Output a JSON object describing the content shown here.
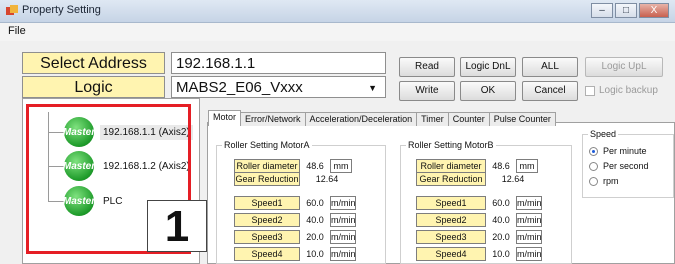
{
  "window": {
    "title": "Property Setting",
    "min_label": "–",
    "max_label": "□",
    "close_label": "X"
  },
  "menu": {
    "file_label": "File"
  },
  "address": {
    "label": "Select Address",
    "value": "192.168.1.1"
  },
  "logic": {
    "label": "Logic",
    "value": "MABS2_E06_Vxxx"
  },
  "buttons": {
    "read": "Read",
    "logic_dnl": "Logic DnL",
    "all": "ALL",
    "logic_upl": "Logic UpL",
    "write": "Write",
    "ok": "OK",
    "cancel": "Cancel"
  },
  "logic_backup": {
    "label": "Logic backup",
    "checked": false
  },
  "tree": {
    "nodes": [
      {
        "badge": "Master",
        "label": "192.168.1.1 (Axis2)",
        "selected": true
      },
      {
        "badge": "Master",
        "label": "192.168.1.2 (Axis2)",
        "selected": false
      },
      {
        "badge": "Master",
        "label": "PLC",
        "selected": false
      }
    ]
  },
  "callout": {
    "number": "1"
  },
  "tabs": [
    "Motor",
    "Error/Network",
    "Acceleration/Deceleration",
    "Timer",
    "Counter",
    "Pulse Counter"
  ],
  "active_tab": "Motor",
  "motorA": {
    "title": "Roller Setting MotorA",
    "roller_diameter": {
      "label": "Roller diameter",
      "value": "48.6",
      "unit": "mm"
    },
    "gear_reduction": {
      "label": "Gear Reduction",
      "value": "12.64"
    },
    "speeds": [
      {
        "label": "Speed1",
        "value": "60.0",
        "unit": "m/min"
      },
      {
        "label": "Speed2",
        "value": "40.0",
        "unit": "m/min"
      },
      {
        "label": "Speed3",
        "value": "20.0",
        "unit": "m/min"
      },
      {
        "label": "Speed4",
        "value": "10.0",
        "unit": "m/min"
      }
    ]
  },
  "motorB": {
    "title": "Roller Setting MotorB",
    "roller_diameter": {
      "label": "Roller diameter",
      "value": "48.6",
      "unit": "mm"
    },
    "gear_reduction": {
      "label": "Gear Reduction",
      "value": "12.64"
    },
    "speeds": [
      {
        "label": "Speed1",
        "value": "60.0",
        "unit": "m/min"
      },
      {
        "label": "Speed2",
        "value": "40.0",
        "unit": "m/min"
      },
      {
        "label": "Speed3",
        "value": "20.0",
        "unit": "m/min"
      },
      {
        "label": "Speed4",
        "value": "10.0",
        "unit": "m/min"
      }
    ]
  },
  "speed_group": {
    "title": "Speed",
    "options": [
      {
        "label": "Per minute",
        "selected": true
      },
      {
        "label": "Per second",
        "selected": false
      },
      {
        "label": "rpm",
        "selected": false
      }
    ]
  },
  "colors": {
    "highlight_frame": "#e51e25",
    "label_fill": "#fff4b0",
    "master_badge": "#1e9b2a"
  }
}
